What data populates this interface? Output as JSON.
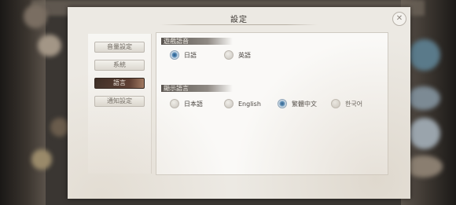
{
  "dialog": {
    "title": "設定",
    "close_symbol": "✕"
  },
  "sidebar": {
    "items": [
      {
        "label": "音量設定",
        "active": false
      },
      {
        "label": "系統",
        "active": false
      },
      {
        "label": "語言",
        "active": true
      },
      {
        "label": "通知設定",
        "active": false
      }
    ]
  },
  "voice_language": {
    "title": "遊戲語音",
    "options": [
      {
        "label": "日語",
        "selected": true
      },
      {
        "label": "英語",
        "selected": false
      }
    ]
  },
  "display_language": {
    "title": "顯示語言",
    "options": [
      {
        "label": "日本語",
        "selected": false
      },
      {
        "label": "English",
        "selected": false
      },
      {
        "label": "繁體中文",
        "selected": true
      },
      {
        "label": "한국어",
        "selected": false
      }
    ]
  },
  "icons": {
    "close": "close-icon",
    "radio": "radio-icon"
  }
}
